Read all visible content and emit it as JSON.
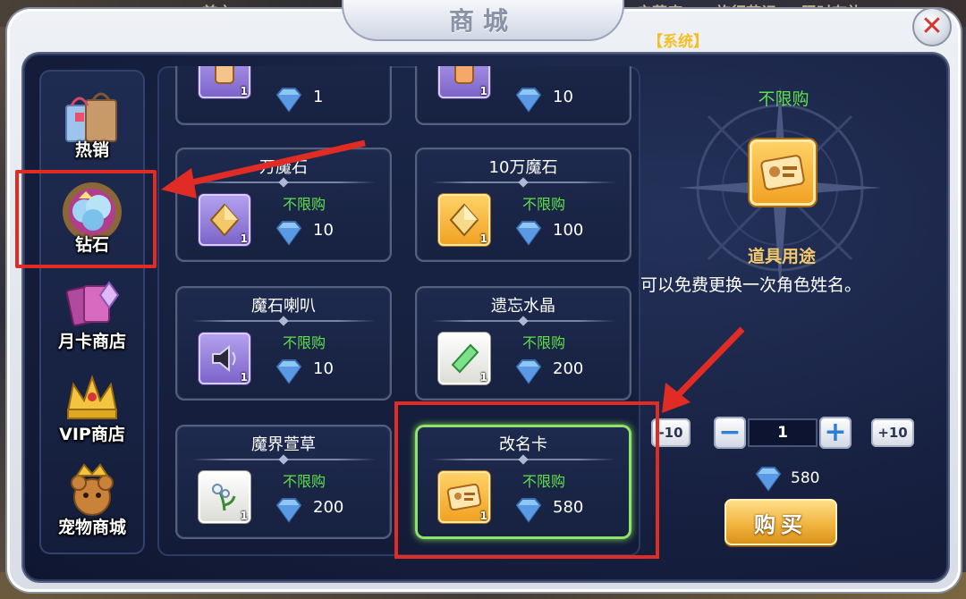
{
  "background": {
    "top_text_1": "首充",
    "top_text_2": "启获度",
    "top_text_3": "旅行花记",
    "top_text_4": "限时有礼"
  },
  "window": {
    "title": "商城",
    "close_icon": "close-x-icon",
    "system_label": "【系统】"
  },
  "sidebar": {
    "items": [
      {
        "label": "热销",
        "icon": "gift-bags-icon"
      },
      {
        "label": "钻石",
        "icon": "diamond-pile-icon",
        "active": true
      },
      {
        "label": "月卡商店",
        "icon": "card-crystal-icon"
      },
      {
        "label": "VIP商店",
        "icon": "crown-icon"
      },
      {
        "label": "宠物商城",
        "icon": "pet-crown-icon"
      }
    ]
  },
  "shop": {
    "currency_icon": "blue-gem-icon",
    "items": [
      {
        "name": "",
        "limit": "",
        "qty": "1",
        "price": "1",
        "icon": "ticket-icon",
        "frame": "purple"
      },
      {
        "name": "",
        "limit": "",
        "qty": "1",
        "price": "10",
        "icon": "ticket-icon",
        "frame": "purple"
      },
      {
        "name": "万魔石",
        "limit": "不限购",
        "qty": "1",
        "price": "10",
        "icon": "magic-stone-icon",
        "frame": "purple"
      },
      {
        "name": "10万魔石",
        "limit": "不限购",
        "qty": "1",
        "price": "100",
        "icon": "magic-stone-icon",
        "frame": "gold"
      },
      {
        "name": "魔石喇叭",
        "limit": "不限购",
        "qty": "1",
        "price": "10",
        "icon": "speaker-icon",
        "frame": "purple"
      },
      {
        "name": "遗忘水晶",
        "limit": "不限购",
        "qty": "1",
        "price": "200",
        "icon": "green-crystal-icon",
        "frame": "white"
      },
      {
        "name": "魔界萱草",
        "limit": "不限购",
        "qty": "1",
        "price": "200",
        "icon": "plant-icon",
        "frame": "white"
      },
      {
        "name": "改名卡",
        "limit": "不限购",
        "qty": "1",
        "price": "580",
        "icon": "id-card-icon",
        "frame": "gold",
        "selected": true
      }
    ]
  },
  "detail": {
    "limit": "不限购",
    "icon": "id-card-icon",
    "use_title": "道具用途",
    "description": "可以免费更换一次角色姓名。",
    "minus10_label": "-10",
    "minus_label": "−",
    "quantity": "1",
    "plus_label": "+",
    "plus10_label": "+10",
    "total_price": "580",
    "buy_label": "购买"
  },
  "colors": {
    "accent_green": "#5fe04a",
    "annotation_red": "#e02c24",
    "system_yellow": "#f2c024",
    "panel_navy": "#172040"
  }
}
